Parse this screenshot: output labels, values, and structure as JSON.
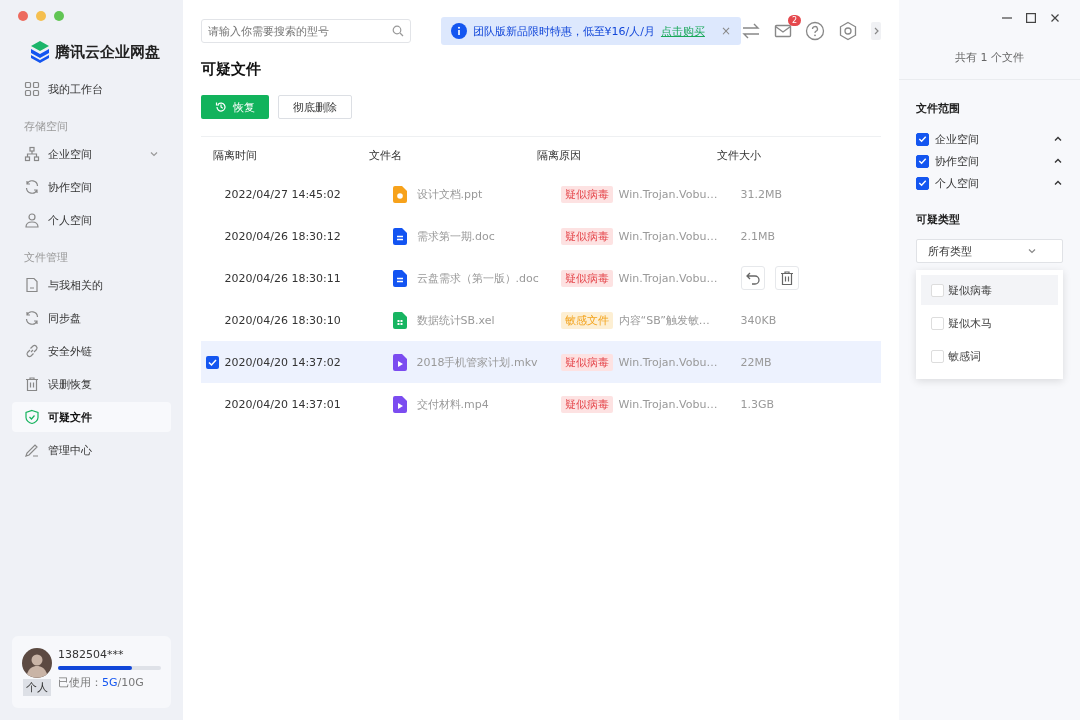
{
  "app": {
    "name": "腾讯云企业网盘"
  },
  "sidebar": {
    "top_item": {
      "label": "我的工作台",
      "selected": false
    },
    "sections": [
      {
        "title": "存储空间",
        "items": [
          {
            "label": "企业空间",
            "selected": false,
            "expandable": true
          },
          {
            "label": "协作空间",
            "selected": false,
            "expandable": false
          },
          {
            "label": "个人空间",
            "selected": false,
            "expandable": false
          }
        ]
      },
      {
        "title": "文件管理",
        "items": [
          {
            "label": "与我相关的",
            "selected": false,
            "expandable": false
          },
          {
            "label": "同步盘",
            "selected": false,
            "expandable": false
          },
          {
            "label": "安全外链",
            "selected": false,
            "expandable": false
          },
          {
            "label": "误删恢复",
            "selected": false,
            "expandable": false
          },
          {
            "label": "可疑文件",
            "selected": true,
            "expandable": false
          },
          {
            "label": "管理中心",
            "selected": false,
            "expandable": false
          }
        ]
      }
    ]
  },
  "user": {
    "name": "1382504***",
    "badge": "个人",
    "used_label": "已使用：",
    "used": "5G",
    "total": "/10G",
    "level": 0.72
  },
  "search": {
    "placeholder": "请输入你需要搜索的型号"
  },
  "banner": {
    "text": "团队版新品限时特惠，低至¥16/人/月",
    "link": "点击购买",
    "close": "×"
  },
  "notifications": {
    "count": "2"
  },
  "page_title": "可疑文件",
  "actions": {
    "restore": "恢复",
    "delete": "彻底删除"
  },
  "table": {
    "columns": [
      "隔离时间",
      "文件名",
      "隔离原因",
      "文件大小"
    ],
    "rows": [
      {
        "time": "2022/04/27 14:45:02",
        "file": {
          "kind": "ppt",
          "name": "设计文档.ppt"
        },
        "tag": {
          "kind": "virus",
          "text": "疑似病毒"
        },
        "reason": "Win.Trojan.Vobu…",
        "size": "31.2MB",
        "selected": false,
        "hovered": false
      },
      {
        "time": "2020/04/26 18:30:12",
        "file": {
          "kind": "doc",
          "name": "需求第一期.doc"
        },
        "tag": {
          "kind": "virus",
          "text": "疑似病毒"
        },
        "reason": "Win.Trojan.Vobu…",
        "size": "2.1MB",
        "selected": false,
        "hovered": false
      },
      {
        "time": "2020/04/26 18:30:11",
        "file": {
          "kind": "doc",
          "name": "云盘需求（第一版）.doc"
        },
        "tag": {
          "kind": "virus",
          "text": "疑似病毒"
        },
        "reason": "Win.Trojan.Vobu…",
        "selected": false,
        "hovered": true
      },
      {
        "time": "2020/04/26 18:30:10",
        "file": {
          "kind": "sheet",
          "name": "数据统计SB.xel"
        },
        "tag": {
          "kind": "sensitive",
          "text": "敏感文件"
        },
        "reason": "内容“SB”触发敏…",
        "size": "340KB",
        "selected": false,
        "hovered": false
      },
      {
        "time": "2020/04/20 14:37:02",
        "file": {
          "kind": "video",
          "name": "2018手机管家计划.mkv"
        },
        "tag": {
          "kind": "virus",
          "text": "疑似病毒"
        },
        "reason": "Win.Trojan.Vobu…",
        "size": "22MB",
        "selected": true,
        "hovered": false
      },
      {
        "time": "2020/04/20 14:37:01",
        "file": {
          "kind": "video",
          "name": "交付材料.mp4"
        },
        "tag": {
          "kind": "virus",
          "text": "疑似病毒"
        },
        "reason": "Win.Trojan.Vobu…",
        "size": "1.3GB",
        "selected": false,
        "hovered": false
      }
    ]
  },
  "filter_panel": {
    "count_text": "共有 1 个文件",
    "scope_title": "文件范围",
    "scopes": [
      {
        "label": "企业空间",
        "checked": true
      },
      {
        "label": "协作空间",
        "checked": true
      },
      {
        "label": "个人空间",
        "checked": true
      }
    ],
    "type_title": "可疑类型",
    "type_select": "所有类型",
    "type_options": [
      {
        "label": "疑似病毒",
        "checked": false,
        "highlighted": true
      },
      {
        "label": "疑似木马",
        "checked": false,
        "highlighted": false
      },
      {
        "label": "敏感词",
        "checked": false,
        "highlighted": false
      }
    ]
  }
}
